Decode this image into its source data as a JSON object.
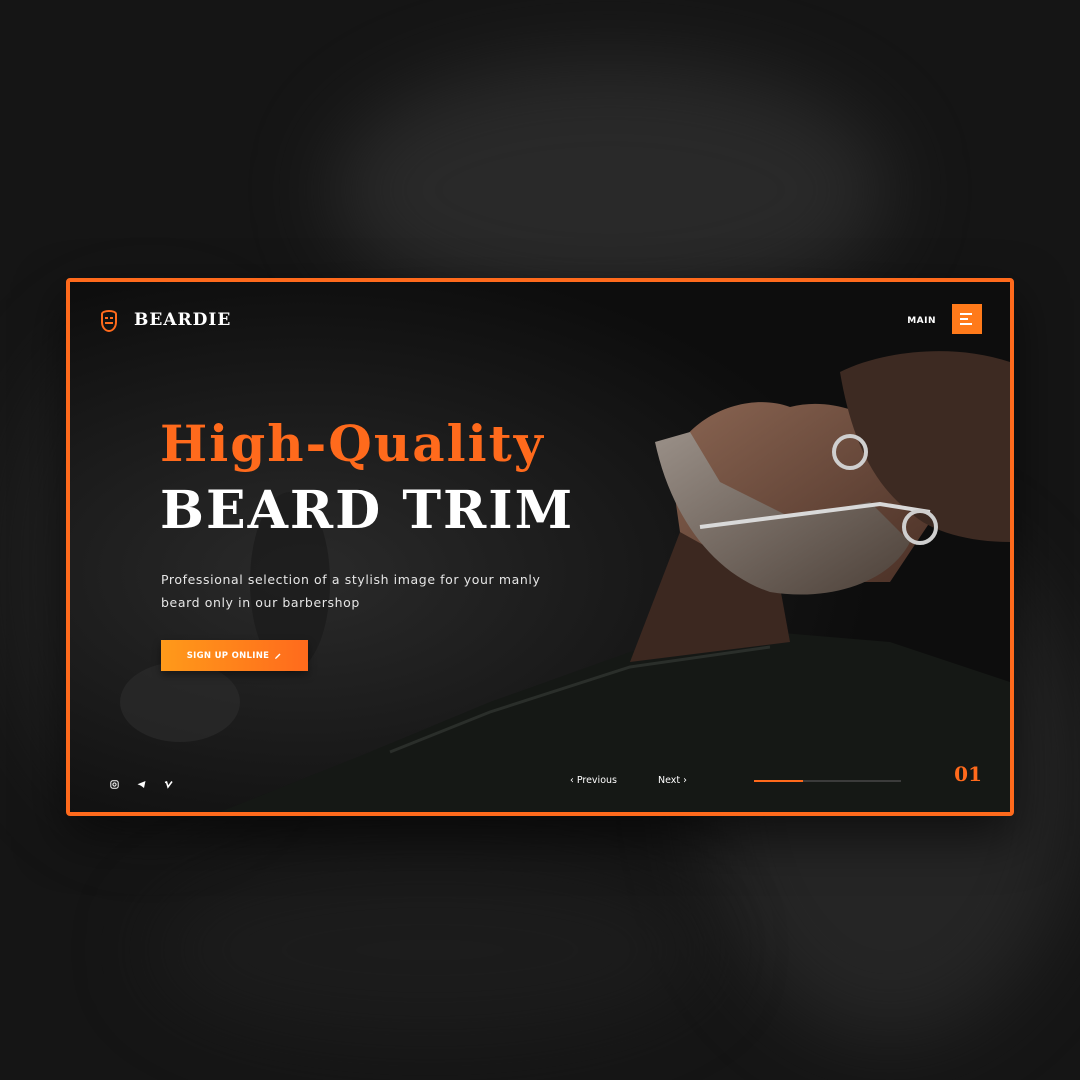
{
  "brand": {
    "name": "BEARDIE",
    "icon": "bearded-face-icon"
  },
  "nav": {
    "main_label": "MAIN",
    "menu_icon": "hamburger-icon"
  },
  "hero": {
    "title_line1": "High-Quality",
    "title_line2": "BEARD TRIM",
    "description": "Professional selection of a stylish image for your manly beard only in our barbershop",
    "cta_label": "SIGN UP ONLINE",
    "cta_icon": "pencil-icon"
  },
  "social": [
    {
      "icon": "instagram-icon"
    },
    {
      "icon": "telegram-icon"
    },
    {
      "icon": "vimeo-icon"
    }
  ],
  "slider": {
    "prev_label": "Previous",
    "next_label": "Next",
    "progress": 0.33,
    "current": "01"
  },
  "colors": {
    "accent": "#ff6a1c",
    "accent_light": "#ff9a1a",
    "background": "#0f0f0f"
  }
}
